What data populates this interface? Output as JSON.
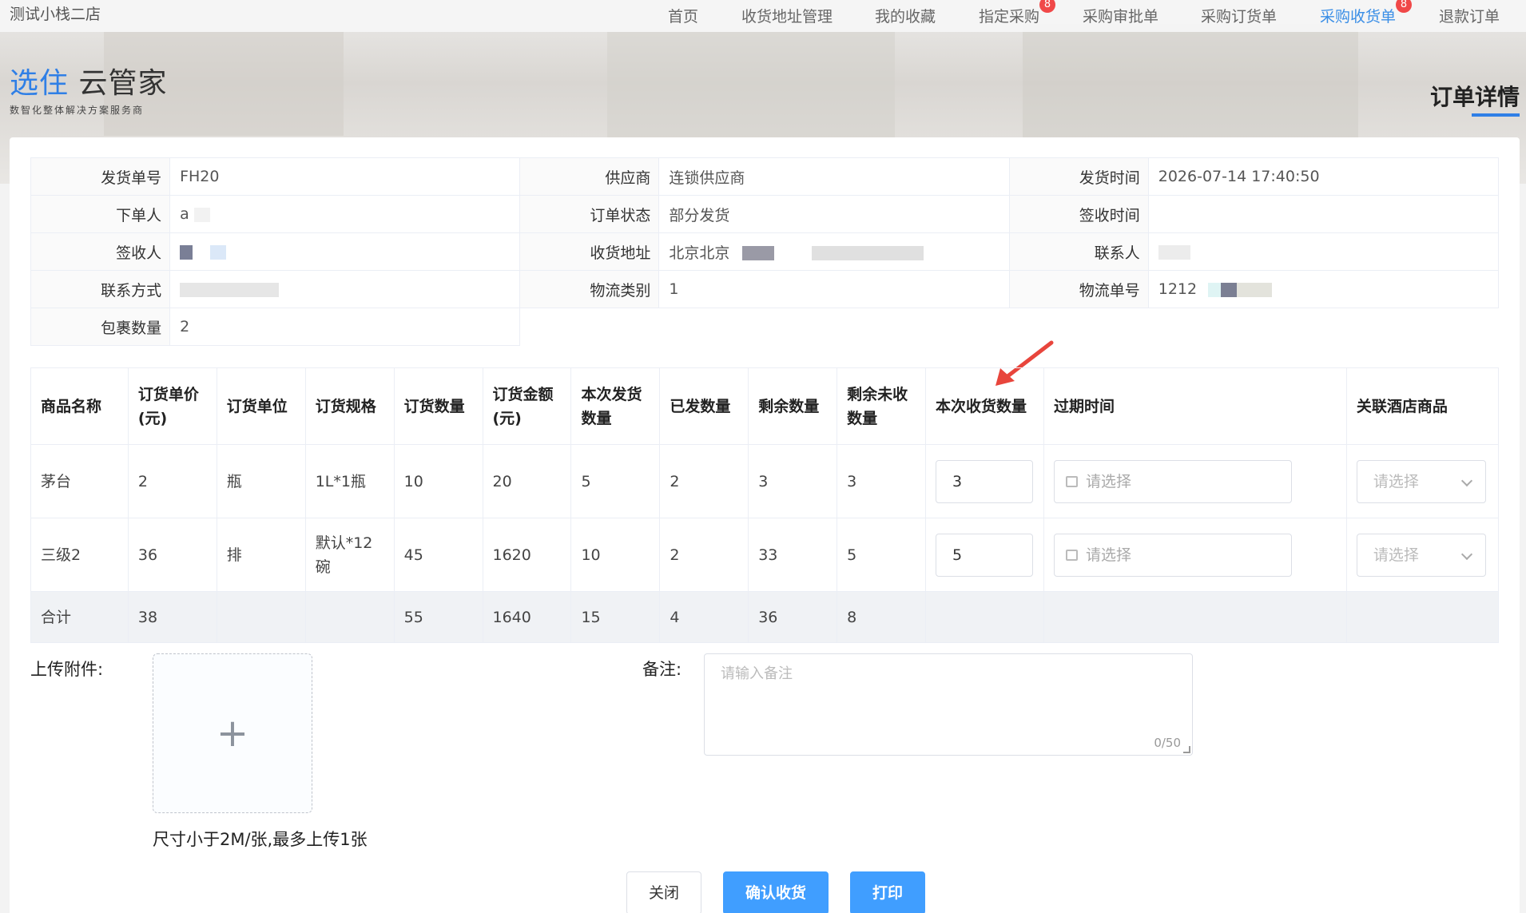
{
  "header": {
    "store_name": "测试小栈二店",
    "nav": [
      {
        "label": "首页"
      },
      {
        "label": "收货地址管理"
      },
      {
        "label": "我的收藏"
      },
      {
        "label": "指定采购",
        "badge": "8"
      },
      {
        "label": "采购审批单"
      },
      {
        "label": "采购订货单"
      },
      {
        "label": "采购收货单",
        "badge": "8"
      },
      {
        "label": "退款订单"
      }
    ],
    "logo_brand": "选住",
    "logo_product": "云管家",
    "logo_tagline": "数智化整体解决方案服务商",
    "page_title": "订单详情"
  },
  "info": {
    "ship_no_label": "发货单号",
    "ship_no": "FH20",
    "supplier_label": "供应商",
    "supplier": "连锁供应商",
    "ship_time_label": "发货时间",
    "ship_time": "2026-07-14 17:40:50",
    "orderer_label": "下单人",
    "orderer": "a",
    "status_label": "订单状态",
    "status": "部分发货",
    "sign_time_label": "签收时间",
    "sign_time": "",
    "signer_label": "签收人",
    "address_label": "收货地址",
    "address": "北京北京",
    "contact_label": "联系人",
    "phone_label": "联系方式",
    "logistics_type_label": "物流类别",
    "logistics_type": "1",
    "tracking_label": "物流单号",
    "tracking": "1212",
    "packages_label": "包裹数量",
    "packages": "2"
  },
  "goods": {
    "headers": {
      "name": "商品名称",
      "price": "订货单价(元)",
      "unit": "订货单位",
      "spec": "订货规格",
      "qty": "订货数量",
      "amount": "订货金额(元)",
      "this_ship": "本次发货数量",
      "shipped": "已发数量",
      "remaining": "剩余数量",
      "unreceived": "剩余未收数量",
      "this_receive": "本次收货数量",
      "expiry": "过期时间",
      "hotel_goods": "关联酒店商品"
    },
    "rows": [
      {
        "name": "茅台",
        "price": "2",
        "unit": "瓶",
        "spec": "1L*1瓶",
        "qty": "10",
        "amount": "20",
        "this_ship": "5",
        "shipped": "2",
        "remaining": "3",
        "unreceived": "3",
        "this_receive": "3"
      },
      {
        "name": "三级2",
        "price": "36",
        "unit": "排",
        "spec": "默认*12碗",
        "qty": "45",
        "amount": "1620",
        "this_ship": "10",
        "shipped": "2",
        "remaining": "33",
        "unreceived": "5",
        "this_receive": "5"
      }
    ],
    "total": {
      "label": "合计",
      "price": "38",
      "qty": "55",
      "amount": "1640",
      "this_ship": "15",
      "shipped": "4",
      "remaining": "36",
      "unreceived": "8"
    },
    "date_placeholder": "请选择",
    "select_placeholder": "请选择"
  },
  "upload": {
    "label": "上传附件:",
    "hint": "尺寸小于2M/张,最多上传1张",
    "plus": "+"
  },
  "remark": {
    "label": "备注:",
    "placeholder": "请输入备注",
    "count": "0/50"
  },
  "buttons": {
    "close": "关闭",
    "confirm": "确认收货",
    "print": "打印"
  }
}
